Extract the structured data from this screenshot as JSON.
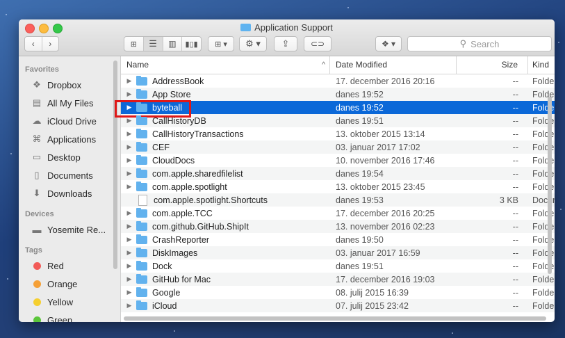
{
  "window": {
    "title": "Application Support"
  },
  "toolbar": {
    "search_placeholder": "Search"
  },
  "sidebar": {
    "sections": [
      {
        "heading": "Favorites",
        "items": [
          {
            "label": "Dropbox",
            "icon": "dropbox-icon"
          },
          {
            "label": "All My Files",
            "icon": "all-files-icon"
          },
          {
            "label": "iCloud Drive",
            "icon": "cloud-icon"
          },
          {
            "label": "Applications",
            "icon": "applications-icon"
          },
          {
            "label": "Desktop",
            "icon": "desktop-icon"
          },
          {
            "label": "Documents",
            "icon": "documents-icon"
          },
          {
            "label": "Downloads",
            "icon": "downloads-icon"
          }
        ]
      },
      {
        "heading": "Devices",
        "items": [
          {
            "label": "Yosemite Re...",
            "icon": "disk-icon"
          }
        ]
      },
      {
        "heading": "Tags",
        "items": [
          {
            "label": "Red",
            "color": "#f25a57"
          },
          {
            "label": "Orange",
            "color": "#f5a037"
          },
          {
            "label": "Yellow",
            "color": "#f5cf2f"
          },
          {
            "label": "Green",
            "color": "#5bc63a"
          }
        ]
      }
    ]
  },
  "columns": {
    "name": "Name",
    "date": "Date Modified",
    "size": "Size",
    "kind": "Kind"
  },
  "files": [
    {
      "name": "AddressBook",
      "date": "17. december 2016 20:16",
      "size": "--",
      "kind": "Folder",
      "type": "folder"
    },
    {
      "name": "App Store",
      "date": "danes 19:52",
      "size": "--",
      "kind": "Folder",
      "type": "folder"
    },
    {
      "name": "byteball",
      "date": "danes 19:52",
      "size": "--",
      "kind": "Folder",
      "type": "folder",
      "selected": true
    },
    {
      "name": "CallHistoryDB",
      "date": "danes 19:51",
      "size": "--",
      "kind": "Folder",
      "type": "folder"
    },
    {
      "name": "CallHistoryTransactions",
      "date": "13. oktober 2015 13:14",
      "size": "--",
      "kind": "Folder",
      "type": "folder"
    },
    {
      "name": "CEF",
      "date": "03. januar 2017 17:02",
      "size": "--",
      "kind": "Folder",
      "type": "folder"
    },
    {
      "name": "CloudDocs",
      "date": "10. november 2016 17:46",
      "size": "--",
      "kind": "Folder",
      "type": "folder"
    },
    {
      "name": "com.apple.sharedfilelist",
      "date": "danes 19:54",
      "size": "--",
      "kind": "Folder",
      "type": "folder"
    },
    {
      "name": "com.apple.spotlight",
      "date": "13. oktober 2015 23:45",
      "size": "--",
      "kind": "Folder",
      "type": "folder"
    },
    {
      "name": "com.apple.spotlight.Shortcuts",
      "date": "danes 19:53",
      "size": "3 KB",
      "kind": "Document",
      "type": "doc"
    },
    {
      "name": "com.apple.TCC",
      "date": "17. december 2016 20:25",
      "size": "--",
      "kind": "Folder",
      "type": "folder"
    },
    {
      "name": "com.github.GitHub.ShipIt",
      "date": "13. november 2016 02:23",
      "size": "--",
      "kind": "Folder",
      "type": "folder"
    },
    {
      "name": "CrashReporter",
      "date": "danes 19:50",
      "size": "--",
      "kind": "Folder",
      "type": "folder"
    },
    {
      "name": "DiskImages",
      "date": "03. januar 2017 16:59",
      "size": "--",
      "kind": "Folder",
      "type": "folder"
    },
    {
      "name": "Dock",
      "date": "danes 19:51",
      "size": "--",
      "kind": "Folder",
      "type": "folder"
    },
    {
      "name": "GitHub for Mac",
      "date": "17. december 2016 19:03",
      "size": "--",
      "kind": "Folder",
      "type": "folder"
    },
    {
      "name": "Google",
      "date": "08. julij 2015 16:39",
      "size": "--",
      "kind": "Folder",
      "type": "folder"
    },
    {
      "name": "iCloud",
      "date": "07. julij 2015 23:42",
      "size": "--",
      "kind": "Folder",
      "type": "folder"
    }
  ]
}
